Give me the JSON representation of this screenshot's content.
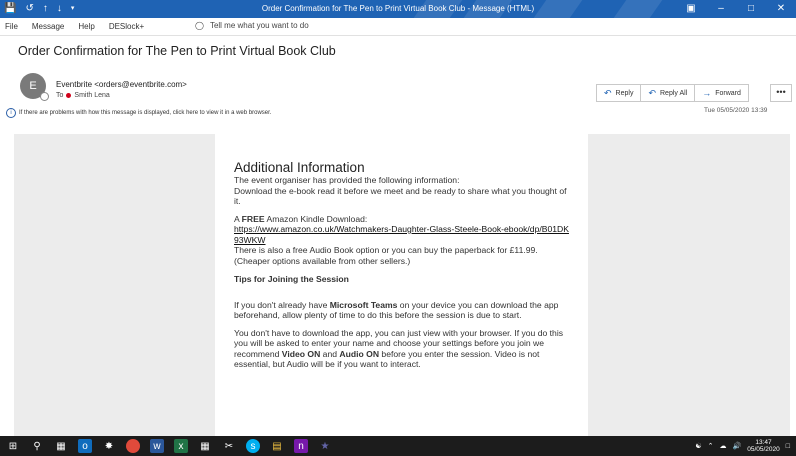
{
  "titlebar": {
    "title": "Order Confirmation for The Pen to Print Virtual Book Club  -  Message (HTML)",
    "quick_access": [
      "save-icon",
      "undo-icon",
      "up-arrow-icon",
      "down-arrow-icon",
      "customize-icon"
    ],
    "window_buttons": [
      "restore-icon",
      "minimize-icon",
      "maximize-icon",
      "close-icon"
    ]
  },
  "menu": {
    "items": [
      "File",
      "Message",
      "Help",
      "DESlock+"
    ],
    "tell_me": "Tell me what you want to do"
  },
  "message": {
    "subject": "Order Confirmation for The Pen to Print Virtual Book Club",
    "avatar_letter": "E",
    "from": "Eventbrite <orders@eventbrite.com>",
    "to_label": "To",
    "to_name": "Smith Lena",
    "info_bar": "If there are problems with how this message is displayed, click here to view it in a web browser.",
    "date": "Tue 05/05/2020 13:39"
  },
  "actions": {
    "reply": "Reply",
    "reply_all": "Reply All",
    "forward": "Forward",
    "more": "•••"
  },
  "body": {
    "heading": "Additional Information",
    "p1": "The event organiser has provided the following information:",
    "p2": "Download the e-book read it before we meet and be ready to share what you thought of it.",
    "free_label": "FREE",
    "free_pre": "A ",
    "free_post": " Amazon Kindle Download:",
    "link": "https://www.amazon.co.uk/Watchmakers-Daughter-Glass-Steele-Book-ebook/dp/B01DK93WKW",
    "p3": "There is also a free Audio Book option or you can buy the paperback for £11.99. (Cheaper options available from other sellers.)",
    "tips": "Tips for Joining the Session",
    "p4_pre": "If you don't already have ",
    "p4_bold": "Microsoft Teams",
    "p4_post": " on your device you can download the app beforehand, allow plenty of time to do this before the session is due to start.",
    "p5_a": "You don't have to download the app, you can  just view with your browser. If you do this you will be asked to enter your name and choose your settings before you join we recommend ",
    "p5_b": "Video ON",
    "p5_c": " and ",
    "p5_d": "Audio ON",
    "p5_e": " before you enter the session. Video is not essential, but Audio will be if you want to interact."
  },
  "taskbar": {
    "time": "13:47",
    "date": "05/05/2020",
    "app_icons": [
      "windows-start-icon",
      "search-icon",
      "task-view-icon",
      "outlook-icon",
      "paint-icon",
      "chrome-icon",
      "word-icon",
      "excel-icon",
      "calculator-icon",
      "snipping-icon",
      "skype-icon",
      "file-explorer-icon",
      "onenote-icon",
      "teams-icon"
    ]
  },
  "colors": {
    "titlebar": "#1f63b4",
    "sidecol": "#ececec",
    "taskbar": "#1c1c1c"
  }
}
